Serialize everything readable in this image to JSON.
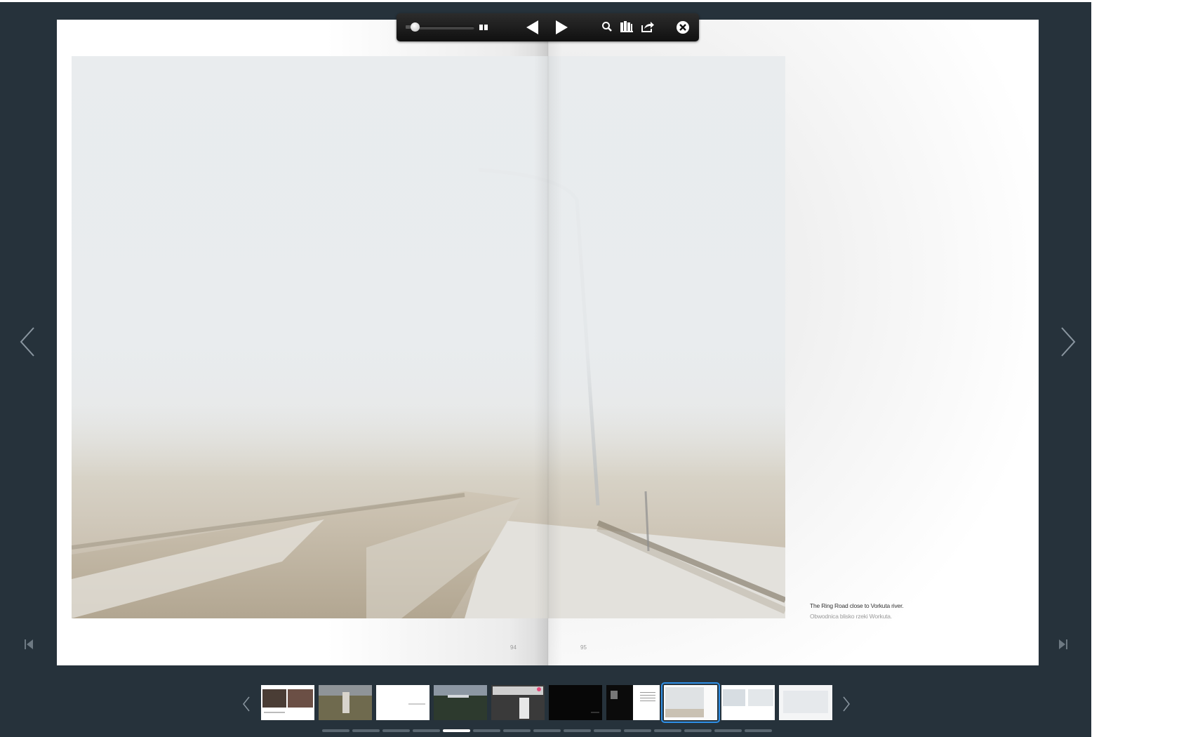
{
  "viewer": {
    "title": ""
  },
  "toolbar": {
    "zoom_level": 0.1,
    "buttons": [
      {
        "name": "zoom-slider-min-icon"
      },
      {
        "name": "two-page-view-icon"
      },
      {
        "name": "previous-page-icon"
      },
      {
        "name": "next-page-icon"
      },
      {
        "name": "search-icon"
      },
      {
        "name": "library-icon"
      },
      {
        "name": "share-icon"
      },
      {
        "name": "close-icon"
      }
    ]
  },
  "spread": {
    "left_page_number": "94",
    "right_page_number": "95",
    "caption_en": "The Ring Road close to Vorkuta river.",
    "caption_pl": "Obwodnica blisko rzeki Workuta."
  },
  "thumbnails": {
    "selected_index": 7,
    "count": 10
  },
  "pagination": {
    "count": 15,
    "active_index": 4
  },
  "colors": {
    "background": "#26323b",
    "selection": "#2f8fe6"
  }
}
